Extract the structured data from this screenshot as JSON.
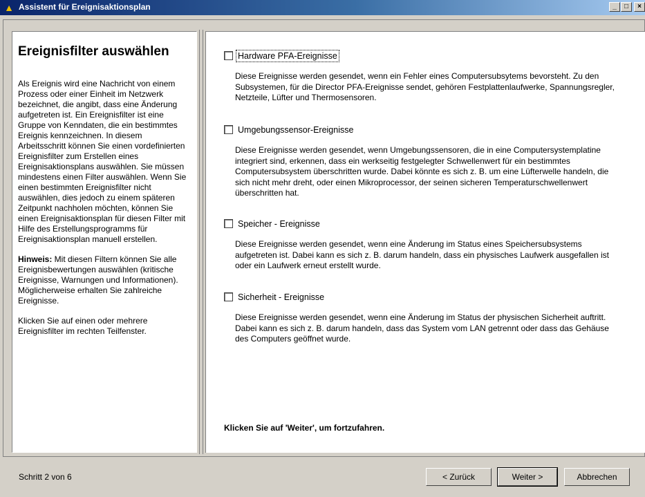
{
  "window": {
    "title": "Assistent für Ereignisaktionsplan",
    "app_icon": "wizard-icon",
    "controls": {
      "minimize": "_",
      "maximize": "□",
      "close": "×"
    }
  },
  "left": {
    "heading": "Ereignisfilter auswählen",
    "paragraph1": "Als Ereignis wird eine Nachricht von einem Prozess oder einer Einheit im Netzwerk bezeichnet, die angibt, dass eine Änderung aufgetreten ist. Ein Ereignisfilter ist eine Gruppe von Kenndaten, die ein bestimmtes Ereignis kennzeichnen. In diesem Arbeitsschritt können Sie einen vordefinierten Ereignisfilter zum Erstellen eines Ereignisaktionsplans auswählen. Sie müssen mindestens einen Filter auswählen. Wenn Sie einen bestimmten Ereignisfilter nicht auswählen, dies jedoch zu einem späteren Zeitpunkt nachholen möchten, können Sie einen Ereignisaktionsplan für diesen Filter mit Hilfe des Erstellungsprogramms für Ereignisaktionsplan manuell erstellen.",
    "hint_label": "Hinweis:",
    "hint_text": " Mit diesen Filtern können Sie alle Ereignisbewertungen auswählen (kritische Ereignisse, Warnungen und Informationen). Möglicherweise erhalten Sie zahlreiche Ereignisse.",
    "paragraph3": "Klicken Sie auf einen oder mehrere Ereignisfilter im rechten Teilfenster."
  },
  "options": [
    {
      "label": "Hardware PFA-Ereignisse",
      "checked": false,
      "description": "Diese Ereignisse werden gesendet, wenn ein Fehler eines Computersubsytems bevorsteht. Zu den Subsystemen, für die Director PFA-Ereignisse sendet, gehören Festplattenlaufwerke, Spannungsregler, Netzteile, Lüfter und Thermosensoren."
    },
    {
      "label": "Umgebungssensor-Ereignisse",
      "checked": false,
      "description": "Diese Ereignisse werden gesendet, wenn Umgebungssensoren, die in eine Computersystemplatine integriert sind, erkennen, dass ein werkseitig festgelegter Schwellenwert für ein bestimmtes Computersubsystem überschritten wurde. Dabei könnte es sich z. B. um eine Lüfterwelle handeln, die sich nicht mehr dreht, oder einen Mikroprocessor, der seinen sicheren Temperaturschwellenwert überschritten hat."
    },
    {
      "label": "Speicher - Ereignisse",
      "checked": false,
      "description": "Diese Ereignisse werden gesendet, wenn eine Änderung im Status eines Speichersubsystems aufgetreten ist. Dabei kann es sich z. B. darum handeln, dass ein physisches Laufwerk ausgefallen ist oder ein Laufwerk erneut erstellt wurde."
    },
    {
      "label": "Sicherheit - Ereignisse",
      "checked": false,
      "description": "Diese Ereignisse werden gesendet, wenn eine Änderung im Status der physischen Sicherheit auftritt. Dabei kann es sich z. B. darum handeln, dass das System vom LAN getrennt oder dass das Gehäuse des Computers geöffnet wurde."
    }
  ],
  "continue_hint": "Klicken Sie auf 'Weiter', um fortzufahren.",
  "footer": {
    "step": "Schritt 2 von 6",
    "back": "< Zurück",
    "next": "Weiter >",
    "cancel": "Abbrechen"
  }
}
